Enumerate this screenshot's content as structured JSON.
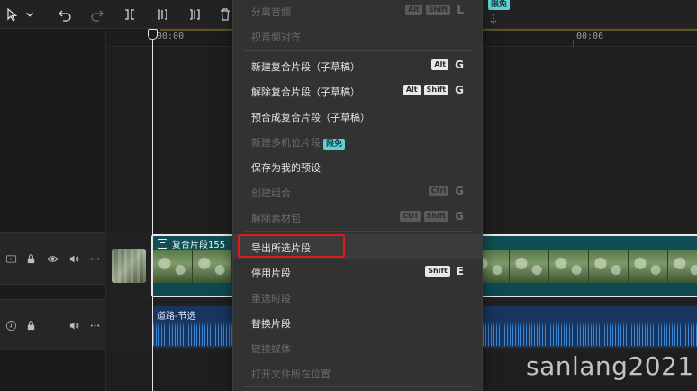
{
  "ruler": {
    "label_start": "00:00",
    "label_end": "00:06"
  },
  "tracks": {
    "video_clip_title": "复合片段155",
    "audio_clip_title": "道路-节选"
  },
  "top_badge": "限免",
  "menu": {
    "items": [
      {
        "label": "分离音频",
        "keys": [
          "Alt",
          "Shift"
        ],
        "letter": "L",
        "disabled": true
      },
      {
        "label": "视音频对齐",
        "disabled": true
      },
      {
        "label": "新建复合片段（子草稿）",
        "keys": [
          "Alt"
        ],
        "letter": "G",
        "disabled": false
      },
      {
        "label": "解除复合片段（子草稿）",
        "keys": [
          "Alt",
          "Shift"
        ],
        "letter": "G",
        "disabled": false
      },
      {
        "label": "预合成复合片段（子草稿）",
        "disabled": false
      },
      {
        "label": "新建多机位片段",
        "badge": "限免",
        "disabled": true
      },
      {
        "label": "保存为我的预设",
        "disabled": false
      },
      {
        "label": "创建组合",
        "keys": [
          "Ctrl"
        ],
        "letter": "G",
        "disabled": true
      },
      {
        "label": "解除素材包",
        "keys": [
          "Ctrl",
          "Shift"
        ],
        "letter": "G",
        "disabled": true
      },
      {
        "label": "导出所选片段",
        "disabled": false,
        "hover": true
      },
      {
        "label": "停用片段",
        "keys": [
          "Shift"
        ],
        "letter": "E",
        "disabled": false
      },
      {
        "label": "重选时段",
        "disabled": true
      },
      {
        "label": "替换片段",
        "disabled": false
      },
      {
        "label": "链接媒体",
        "disabled": true
      },
      {
        "label": "打开文件所在位置",
        "disabled": true
      }
    ]
  },
  "watermark": "sanlang2021",
  "colors": {
    "highlight": "#e01b1b",
    "clip_teal": "#10585e",
    "audio_blue": "#17355f",
    "badge": "#5fd0d6"
  }
}
